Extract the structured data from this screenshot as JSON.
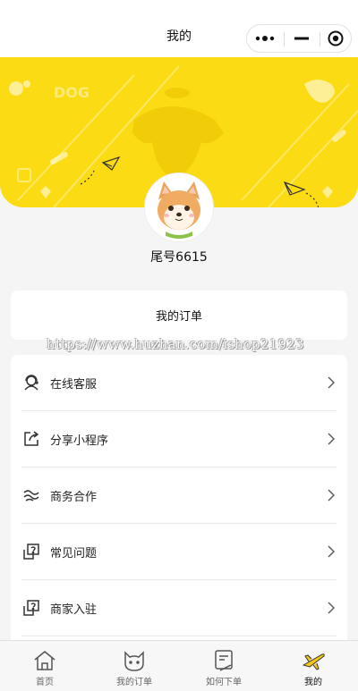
{
  "nav": {
    "title": "我的",
    "capsule_more_icon": "more-dots-icon",
    "capsule_min_icon": "minimize-icon",
    "capsule_close_icon": "record-close-icon"
  },
  "banner": {
    "color": "#fadb14"
  },
  "user": {
    "name": "尾号6615",
    "avatar_icon": "shiba-dog-avatar"
  },
  "order": {
    "title": "我的订单"
  },
  "watermark": "https://www.huzhan.com/ishop21923",
  "menu": [
    {
      "label": "在线客服",
      "icon": "customer-service-icon"
    },
    {
      "label": "分享小程序",
      "icon": "share-icon"
    },
    {
      "label": "商务合作",
      "icon": "cooperation-icon"
    },
    {
      "label": "常见问题",
      "icon": "faq-icon"
    },
    {
      "label": "商家入驻",
      "icon": "merchant-join-icon"
    }
  ],
  "tabs": [
    {
      "label": "首页",
      "icon": "home-icon",
      "active": false
    },
    {
      "label": "我的订单",
      "icon": "cat-icon",
      "active": false
    },
    {
      "label": "如何下单",
      "icon": "how-to-order-icon",
      "active": false
    },
    {
      "label": "我的",
      "icon": "plane-icon",
      "active": true
    }
  ]
}
